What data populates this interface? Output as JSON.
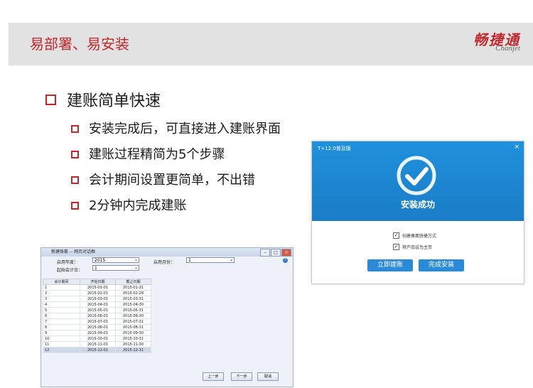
{
  "header": {
    "title": "易部署、易安装",
    "logo_cn": "畅捷通",
    "logo_en": "Chanjet"
  },
  "main": {
    "heading": "建账简单快速",
    "bullets": [
      "安装完成后，可直接进入建账界面",
      "建账过程精简为5个步骤",
      "会计期间设置更简单，不出错",
      "2分钟内完成建账"
    ]
  },
  "install_dialog": {
    "title": "T+12.0普及版",
    "close": "×",
    "status": "安装成功",
    "checkbox1": "创建桌面快捷方式",
    "checkbox2": "将产品设为主页",
    "checkbox1_checked": true,
    "checkbox2_checked": true,
    "btn_create": "立即建账",
    "btn_finish": "完成安装",
    "accent_color": "#1f8ad6"
  },
  "account_wizard": {
    "title": "新建账套 -- 网页对话框",
    "year_label": "启用年度：",
    "year_value": "2015",
    "month_label": "启用月份：",
    "month_value": "1",
    "start_period_label": "起始会计日：",
    "start_period_value": "1",
    "columns": [
      "会计期间",
      "开始日期",
      "截止日期"
    ],
    "rows": [
      [
        "1",
        "2015-01-01",
        "2015-01-31"
      ],
      [
        "2",
        "2015-02-01",
        "2015-02-28"
      ],
      [
        "3",
        "2015-03-01",
        "2015-03-31"
      ],
      [
        "4",
        "2015-04-01",
        "2015-04-30"
      ],
      [
        "5",
        "2015-05-01",
        "2015-05-31"
      ],
      [
        "6",
        "2015-06-01",
        "2015-06-30"
      ],
      [
        "7",
        "2015-07-01",
        "2015-07-31"
      ],
      [
        "8",
        "2015-08-01",
        "2015-08-31"
      ],
      [
        "9",
        "2015-09-01",
        "2015-09-30"
      ],
      [
        "10",
        "2015-10-01",
        "2015-10-31"
      ],
      [
        "11",
        "2015-11-01",
        "2015-11-30"
      ],
      [
        "12",
        "2015-12-01",
        "2015-12-31"
      ]
    ],
    "btn_prev": "上一步",
    "btn_next": "下一步",
    "btn_cancel": "取消"
  }
}
